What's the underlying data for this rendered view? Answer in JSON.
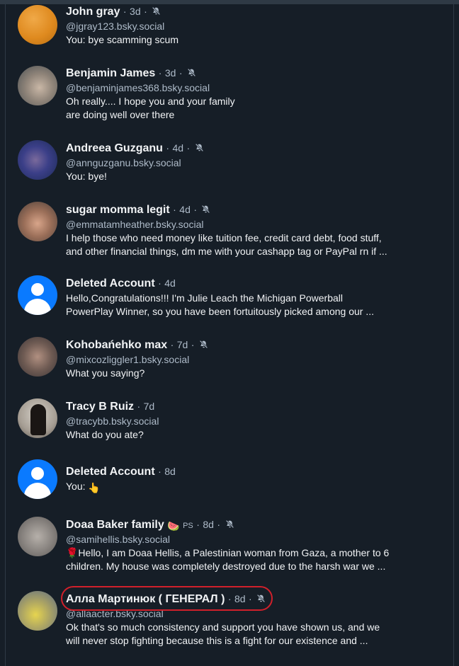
{
  "conversations": [
    {
      "name": "John gray",
      "time": "3d",
      "handle": "@jgray123.bsky.social",
      "message": "You: bye scamming scum",
      "muted": true
    },
    {
      "name": "Benjamin James",
      "time": "3d",
      "handle": "@benjaminjames368.bsky.social",
      "message_lines": [
        "Oh really.... I hope you and your family",
        "are doing well over there"
      ],
      "muted": true
    },
    {
      "name": "Andreea Guzganu",
      "time": "4d",
      "handle": "@annguzganu.bsky.social",
      "message": "You: bye!",
      "muted": true
    },
    {
      "name": "sugar momma legit",
      "time": "4d",
      "handle": "@emmatamheather.bsky.social",
      "message_lines": [
        "I help those who need money like tuition fee, credit card debt, food stuff,",
        "and other financial things, dm me with your cashapp tag  or PayPal rn if ..."
      ],
      "muted": true
    },
    {
      "name": "Deleted Account",
      "time": "4d",
      "message_lines": [
        "Hello,Congratulations!!! I'm Julie Leach the Michigan Powerball",
        "PowerPlay Winner, so you have been fortuitously picked among our ..."
      ],
      "muted": false
    },
    {
      "name": "Kohobańehko max",
      "time": "7d",
      "handle": "@mixcozliggler1.bsky.social",
      "message": "What you saying?",
      "muted": true
    },
    {
      "name": "Tracy B Ruiz",
      "time": "7d",
      "handle": "@tracybb.bsky.social",
      "message": "What do you ate?",
      "muted": false
    },
    {
      "name": "Deleted Account",
      "time": "8d",
      "message": "You:",
      "message_emoji": "👆",
      "muted": false
    },
    {
      "name": "Doaa Baker family",
      "name_emoji": "🍉",
      "name_suffix": "PS",
      "time": "8d",
      "handle": "@samihellis.bsky.social",
      "message_lines": [
        "🌹Hello, I am Doaa Hellis, a Palestinian woman from Gaza, a mother to 6",
        "children. My house was completely destroyed due to the harsh war we ..."
      ],
      "muted": true
    },
    {
      "name": "Алла Мартинюк ( ГЕНЕРАЛ )",
      "time": "8d",
      "handle": "@allaacter.bsky.social",
      "message_lines": [
        "Ok that's so much consistency and support you have shown us, and we",
        "will never stop fighting because this is a fight for our existence and ..."
      ],
      "muted": true
    }
  ],
  "separator": "·",
  "icons": {
    "mute": "bell-slash-icon",
    "deleted_avatar": "default-user-icon"
  },
  "colors": {
    "background": "#161e27",
    "text": "#f1f3f5",
    "muted_text": "#aebbc9",
    "deleted_avatar": "#0a7aff",
    "annotation": "#d1202b"
  },
  "annotation": {
    "shape": "red-ellipse",
    "target": "Алла Мартинюк ( ГЕНЕРАЛ )"
  }
}
